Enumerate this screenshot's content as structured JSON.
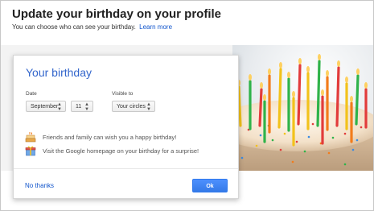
{
  "header": {
    "title": "Update your birthday on your profile",
    "subtitle": "You can choose who can see your birthday.",
    "learn_more": "Learn more"
  },
  "dialog": {
    "title": "Your birthday",
    "date_label": "Date",
    "month_value": "September",
    "day_value": "11",
    "visible_label": "Visible to",
    "visible_value": "Your circles",
    "info": [
      {
        "icon": "cake-icon",
        "text": "Friends and family can wish you a happy birthday!"
      },
      {
        "icon": "gift-icon",
        "text": "Visit the Google homepage on your birthday for a surprise!"
      }
    ],
    "no_thanks": "No thanks",
    "ok": "Ok"
  },
  "colors": {
    "accent": "#3366cc",
    "link": "#1155cc",
    "ok_button": "#4d90fe"
  }
}
